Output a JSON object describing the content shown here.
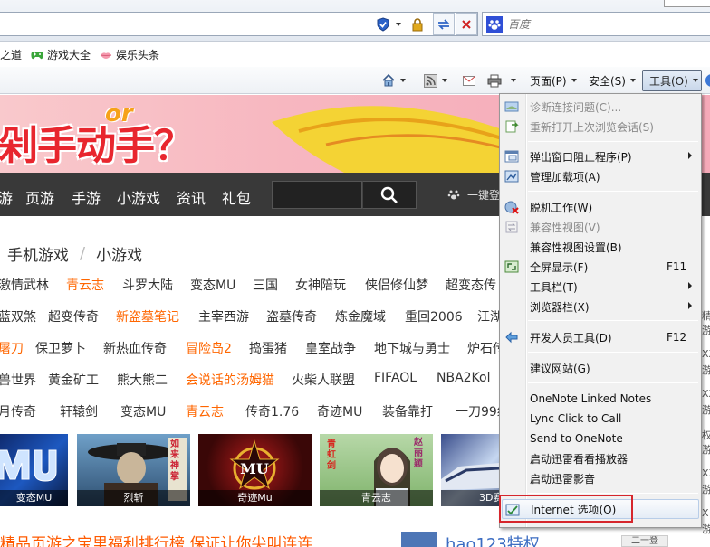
{
  "search": {
    "placeholder": "百度"
  },
  "favorites": [
    {
      "label": "之道",
      "icon": "unknown-favicon"
    },
    {
      "label": "游戏大全",
      "icon": "gamepad-icon"
    },
    {
      "label": "娱乐头条",
      "icon": "lips-icon"
    }
  ],
  "commandbar": {
    "page": "页面(P)",
    "safety": "安全(S)",
    "tools": "工具(O)"
  },
  "banner": {
    "title": "剁手动手？",
    "or": "or"
  },
  "sitenav": {
    "items": [
      "游",
      "页游",
      "手游",
      "小游戏",
      "资讯",
      "礼包"
    ],
    "login": "一键登"
  },
  "tabs": [
    "手机游戏",
    "小游戏"
  ],
  "games": [
    [
      "激情武林",
      "青云志",
      "斗罗大陆",
      "变态MU",
      "三国",
      "女神陪玩",
      "侠侣修仙梦",
      "超变态传"
    ],
    [
      "蓝双煞",
      "超变传奇",
      "新盗墓笔记",
      "主宰西游",
      "盗墓传奇",
      "炼金魔域",
      "重回2006",
      "江湖"
    ],
    [
      "屠刀",
      "保卫萝卜",
      "新热血传奇",
      "冒险岛2",
      "捣蛋猪",
      "皇室战争",
      "地下城与勇士",
      "炉石传"
    ],
    [
      "兽世界",
      "黄金矿工",
      "熊大熊二",
      "会说话的汤姆猫",
      "火柴人联盟",
      "FIFAOL",
      "NBA2Kol"
    ],
    [
      "月传奇",
      "轩辕剑",
      "变态MU",
      "青云志",
      "传奇1.76",
      "奇迹MU",
      "装备靠打",
      "一刀99级"
    ]
  ],
  "thumbs": [
    "变态MU",
    "烈斩",
    "奇迹Mu",
    "青云志",
    "3D赛"
  ],
  "thumb_texts": {
    "rulai": "如来神掌",
    "qhj": "青虹剑",
    "zhaoliying": "赵丽颖"
  },
  "bottom": {
    "title": "精品页游之宝里福利排行榜 保证让你尖叫连连",
    "hao": "hao123特权",
    "hao_btn": "二一登"
  },
  "rstrip": [
    "精",
    "游",
    "XX",
    "游",
    "XX",
    "游",
    "权",
    "游",
    "XX",
    "游",
    "X",
    "游"
  ],
  "menu": {
    "items": [
      {
        "label": "诊断连接问题(C)...",
        "disabled": true,
        "icon": "diagnose-icon"
      },
      {
        "label": "重新打开上次浏览会话(S)",
        "disabled": true,
        "icon": "reopen-session-icon"
      },
      {
        "label": "弹出窗口阻止程序(P)",
        "submenu": true,
        "icon": "popup-blocker-icon"
      },
      {
        "label": "管理加载项(A)",
        "icon": "addons-icon"
      },
      {
        "label": "脱机工作(W)",
        "icon": "offline-icon"
      },
      {
        "label": "兼容性视图(V)",
        "disabled": true,
        "icon": "compat-view-icon"
      },
      {
        "label": "兼容性视图设置(B)"
      },
      {
        "label": "全屏显示(F)",
        "shortcut": "F11",
        "icon": "fullscreen-icon"
      },
      {
        "label": "工具栏(T)",
        "submenu": true
      },
      {
        "label": "浏览器栏(X)",
        "submenu": true
      },
      {
        "label": "开发人员工具(D)",
        "shortcut": "F12",
        "icon": "devtools-icon"
      },
      {
        "label": "建议网站(G)"
      },
      {
        "label": "OneNote Linked Notes"
      },
      {
        "label": "Lync Click to Call"
      },
      {
        "label": "Send to OneNote"
      },
      {
        "label": "启动迅雷看看播放器"
      },
      {
        "label": "启动迅雷影音"
      },
      {
        "label": "Internet 选项(O)",
        "icon": "internet-options-icon",
        "highlighted": true
      }
    ]
  },
  "colors": {
    "accent_orange": "#ff6600",
    "banner_red": "#e8262e",
    "nav_bg": "#393939",
    "highlight_red": "#d6262c"
  }
}
